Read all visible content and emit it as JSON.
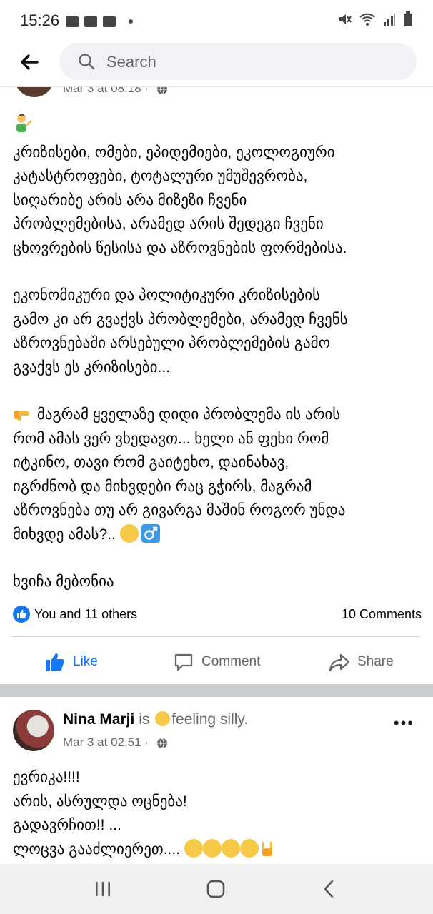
{
  "status_bar": {
    "time": "15:26"
  },
  "search": {
    "placeholder": "Search"
  },
  "post1": {
    "meta_partial": "Mar 3 at 08:18 ·",
    "lines_p1": [
      "კრიზისები, ომები, ეპიდემიები, ეკოლოგიური",
      "კატასტროფები, ტოტალური უმუშევრობა,",
      "სიღარიბე არის არა მიზეზი ჩვენი",
      "პრობლემებისა, არამედ არის შედეგი ჩვენი",
      "ცხოვრების წესისა და აზროვნების ფორმებისა."
    ],
    "lines_p2": [
      "ეკონომიკური და პოლიტიკური კრიზისების",
      "გამო კი არ გვაქვს პრობლემები, არამედ ჩვენს",
      "აზროვნებაში არსებული პრობლემების გამო",
      "გვაქვს ეს კრიზისები..."
    ],
    "p3_line1": " მაგრამ ყველაზე დიდი პრობლემა ის არის",
    "lines_p3": [
      "რომ ამას ვერ ვხედავთ... ხელი ან ფეხი რომ",
      "იტკინო, თავი რომ გაიტეხო, დაინახავ,",
      "იგრძნობ და მიხვდები რაც გჭირს, მაგრამ",
      "აზროვნება თუ არ გივარგა მაშინ როგორ უნდა"
    ],
    "p3_last": "მიხვდე  ამას?..  ",
    "signature": "ხვიჩა მებონია",
    "reactions_text": "You and 11 others",
    "comments_count": "10 Comments",
    "like_label": "Like",
    "comment_label": "Comment",
    "share_label": "Share"
  },
  "post2": {
    "author": "Nina Marji",
    "is_word": " is ",
    "feeling": "feeling silly.",
    "date": "Mar 3 at 02:51 ·",
    "lines": [
      "ევრიკა!!!!",
      "არის, ასრულდა ოცნება!",
      "გადავრჩით!! ...",
      "ლოცვა გააძლიერეთ.... "
    ]
  },
  "colors": {
    "accent": "#1877f2",
    "muted": "#65676b",
    "divider": "#c9ccd1"
  }
}
